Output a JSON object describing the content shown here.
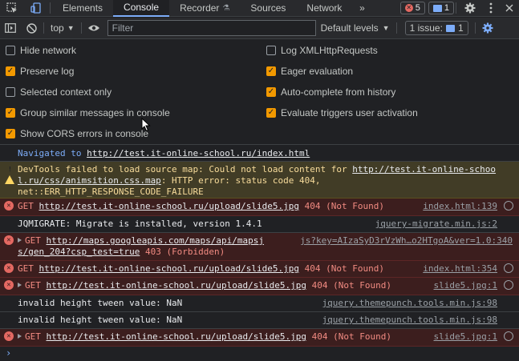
{
  "tabbar": {
    "tabs": [
      {
        "label": "Elements"
      },
      {
        "label": "Console"
      },
      {
        "label": "Recorder"
      },
      {
        "label": "Sources"
      },
      {
        "label": "Network"
      }
    ],
    "more_label": "»",
    "error_count": "5",
    "message_count": "1"
  },
  "toolbar": {
    "context": "top",
    "filter_placeholder": "Filter",
    "levels": "Default levels",
    "issue_label": "1 issue:",
    "issue_count": "1"
  },
  "settings": {
    "left": [
      {
        "label": "Hide network",
        "checked": false
      },
      {
        "label": "Preserve log",
        "checked": true
      },
      {
        "label": "Selected context only",
        "checked": false
      },
      {
        "label": "Group similar messages in console",
        "checked": true
      },
      {
        "label": "Show CORS errors in console",
        "checked": true
      }
    ],
    "right": [
      {
        "label": "Log XMLHttpRequests",
        "checked": false
      },
      {
        "label": "Eager evaluation",
        "checked": true
      },
      {
        "label": "Auto-complete from history",
        "checked": true
      },
      {
        "label": "Evaluate triggers user activation",
        "checked": true
      }
    ]
  },
  "console": {
    "nav": {
      "prefix": "Navigated to ",
      "url": "http://test.it-online-school.ru/index.html"
    },
    "warning": {
      "line1_pre": "DevTools failed to load source map: Could not load content for ",
      "line1_link": "http://test.it-online-schoo",
      "line2_link": "l.ru/css/animsition.css.map",
      "line2_post": ": HTTP error: status code 404,",
      "line3": "net::ERR_HTTP_RESPONSE_CODE_FAILURE"
    },
    "err1": {
      "method": "GET ",
      "url": "http://test.it-online-school.ru/upload/slide5.jpg",
      "status": " 404 (Not Found)",
      "source": "index.html:139"
    },
    "info1": {
      "text": "JQMIGRATE: Migrate is installed, version 1.4.1",
      "source": "jquery-migrate.min.js:2"
    },
    "err2": {
      "method": "GET ",
      "url": "http://maps.googleapis.com/maps/api/mapsj",
      "url2": "s/gen_204?csp_test=true",
      "status": " 403 (Forbidden)",
      "source": "js?key=AIzaSyD3rVzWh…o2HTgoA&ver=1.0:340"
    },
    "err3": {
      "method": "GET ",
      "url": "http://test.it-online-school.ru/upload/slide5.jpg",
      "status": " 404 (Not Found)",
      "source": "index.html:354"
    },
    "err4": {
      "method": "GET ",
      "url": "http://test.it-online-school.ru/upload/slide5.jpg",
      "status": " 404 (Not Found)",
      "source": "slide5.jpg:1"
    },
    "info2": {
      "text": "invalid height tween value: NaN",
      "source": "jquery.themepunch.tools.min.js:98"
    },
    "info3": {
      "text": "invalid height tween value: NaN",
      "source": "jquery.themepunch.tools.min.js:98"
    },
    "err5": {
      "method": "GET ",
      "url": "http://test.it-online-school.ru/upload/slide5.jpg",
      "status": " 404 (Not Found)",
      "source": "slide5.jpg:1"
    },
    "prompt": "›"
  },
  "colors": {
    "accent": "#7cacf8",
    "error": "#f28b82",
    "warning": "#fdd663",
    "checkbox": "#f29900"
  }
}
